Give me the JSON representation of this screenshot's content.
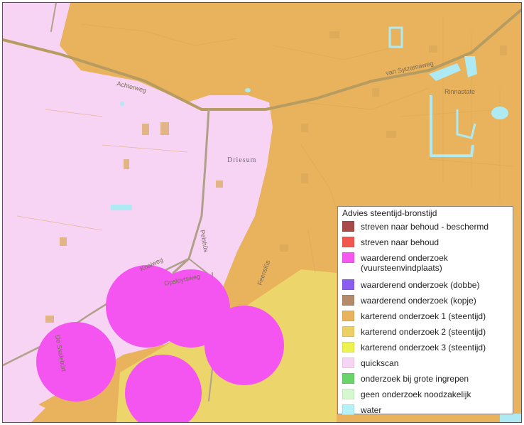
{
  "map": {
    "place_label": "Driesum",
    "street_labels": [
      "Achterweg",
      "van Sytzamaweg",
      "Rinnastate",
      "Opsloytsweg",
      "Koaiweg",
      "Pelshûs",
      "Feenslûs",
      "De Skalebûrt"
    ]
  },
  "legend": {
    "title": "Advies steentijd-bronstijd",
    "items": [
      {
        "label": "streven naar behoud - beschermd",
        "color": "#a84a4a"
      },
      {
        "label": "streven naar behoud",
        "color": "#f2574f"
      },
      {
        "label": "waarderend onderzoek (vuursteenvindplaats)",
        "color": "#f558f0"
      },
      {
        "label": "waarderend onderzoek (dobbe)",
        "color": "#8a5cf0"
      },
      {
        "label": "waarderend onderzoek (kopje)",
        "color": "#b58a6a"
      },
      {
        "label": "karterend onderzoek 1 (steentijd)",
        "color": "#e8b35c"
      },
      {
        "label": "karterend onderzoek 2 (steentijd)",
        "color": "#ecd066"
      },
      {
        "label": "karterend onderzoek 3 (steentijd)",
        "color": "#edf24e"
      },
      {
        "label": "quickscan",
        "color": "#f7d4f3"
      },
      {
        "label": "onderzoek bij grote ingrepen",
        "color": "#6ad46a"
      },
      {
        "label": "geen onderzoek noodzakelijk",
        "color": "#d6f7d0"
      },
      {
        "label": "water",
        "color": "#b5f2f7"
      }
    ]
  }
}
